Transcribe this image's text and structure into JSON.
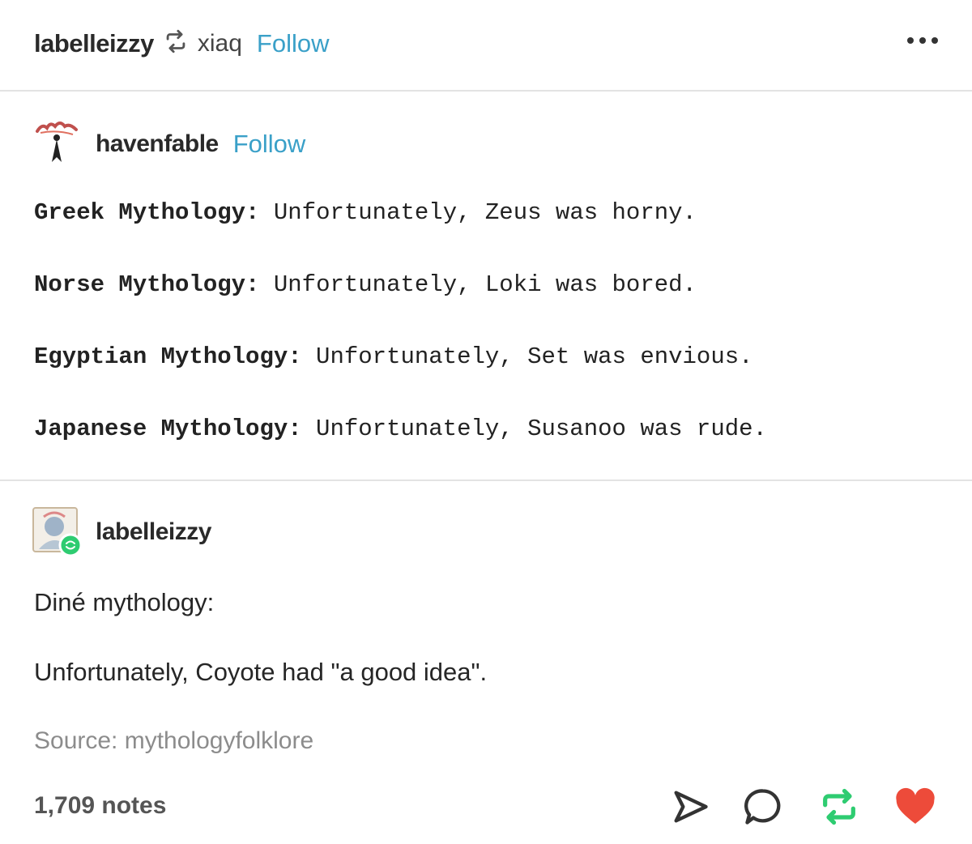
{
  "header": {
    "reblogger": "labelleizzy",
    "via_user": "xiaq",
    "follow_label": "Follow"
  },
  "original_post": {
    "author": "havenfable",
    "follow_label": "Follow",
    "lines": [
      {
        "label": "Greek Mythology:",
        "text": " Unfortunately, Zeus was horny."
      },
      {
        "label": "Norse Mythology:",
        "text": " Unfortunately, Loki was bored."
      },
      {
        "label": "Egyptian Mythology:",
        "text": " Unfortunately, Set was envious."
      },
      {
        "label": "Japanese Mythology:",
        "text": " Unfortunately, Susanoo was rude."
      }
    ]
  },
  "reblog": {
    "author": "labelleizzy",
    "line1": "Diné mythology:",
    "line2": "Unfortunately, Coyote had \"a good idea\"."
  },
  "footer": {
    "source": "Source: mythologyfolklore",
    "notes": "1,709 notes"
  },
  "icons": {
    "reblog_color": "#2ecc71",
    "like_color": "#ed4b3a",
    "follow_color": "#3aa0c8"
  }
}
